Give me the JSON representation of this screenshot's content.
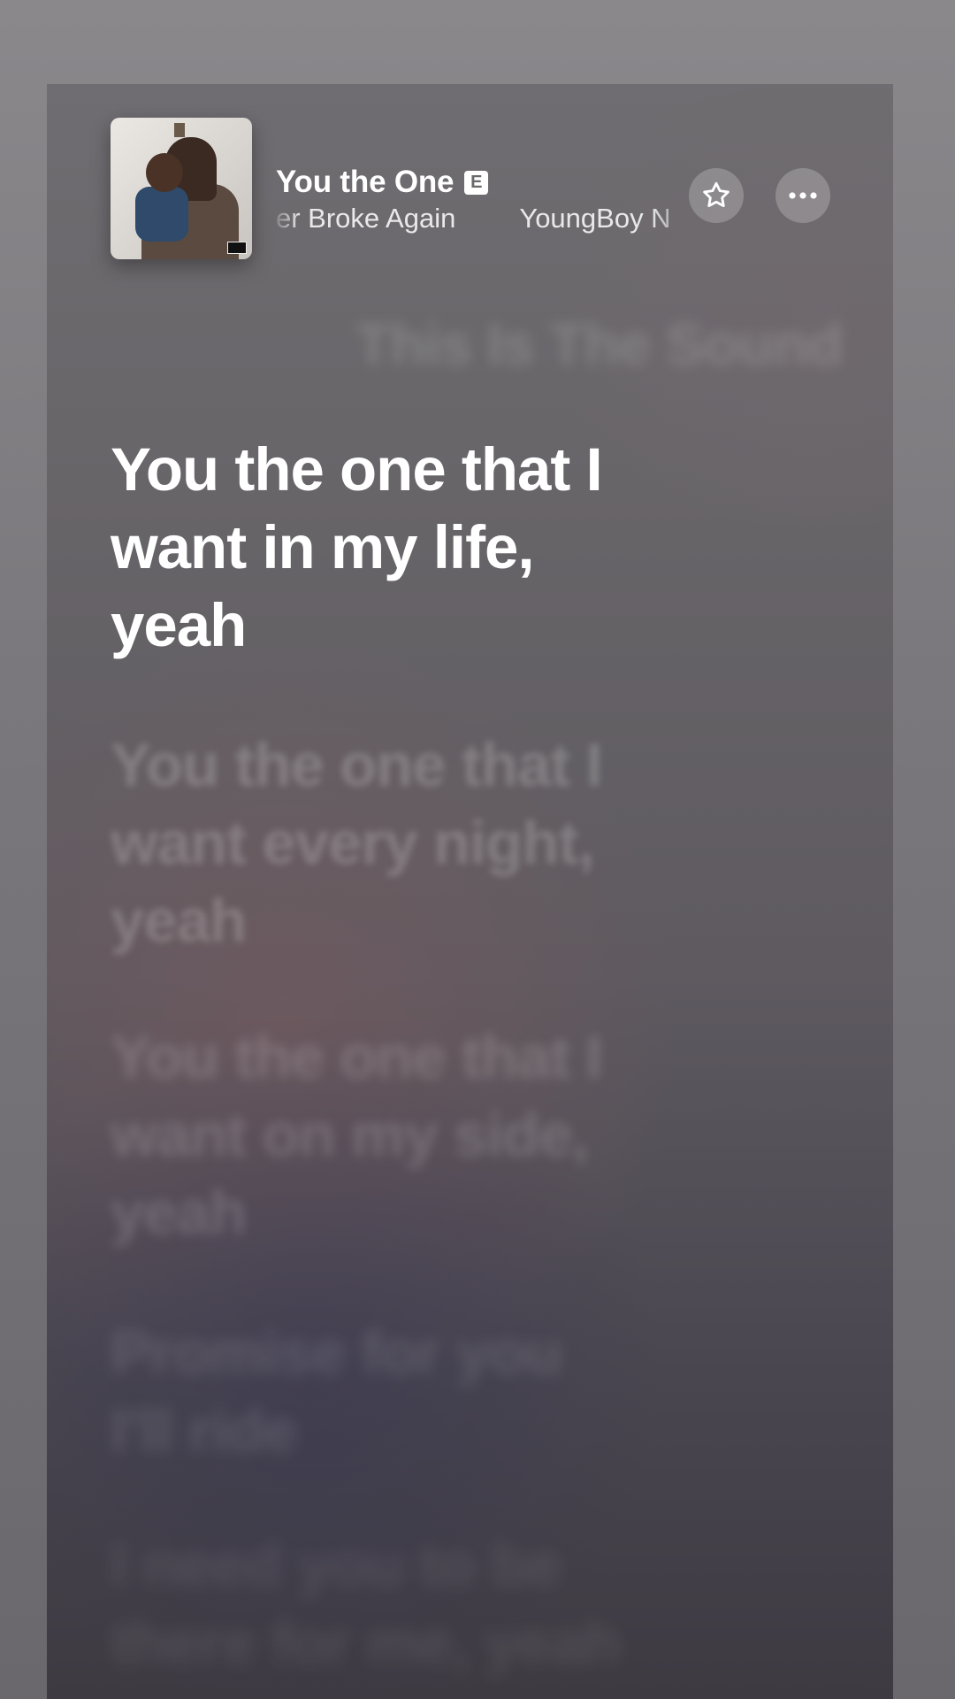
{
  "now_playing": {
    "title": "You the One",
    "explicit_badge": "E",
    "subtitle_album": "Until Death Call My Name / Never Broke Again",
    "subtitle_album_visible": "er Broke Again",
    "subtitle_artist": "YoungBoy N",
    "favorite_icon": "star-icon",
    "more_icon": "ellipsis-icon"
  },
  "lyrics": {
    "previous": "This Is The Sound",
    "current": "You the one that I\nwant in my life,\nyeah",
    "upcoming": [
      "You the one that I\nwant every night,\nyeah",
      "You the one that I\nwant on my side,\nyeah",
      "Promise for you\nI'll ride",
      "I need you to be\nthere for me, yeah"
    ]
  },
  "colors": {
    "background": "#7a787c",
    "card": "#5e5a60",
    "lyric_active": "#ffffff"
  }
}
